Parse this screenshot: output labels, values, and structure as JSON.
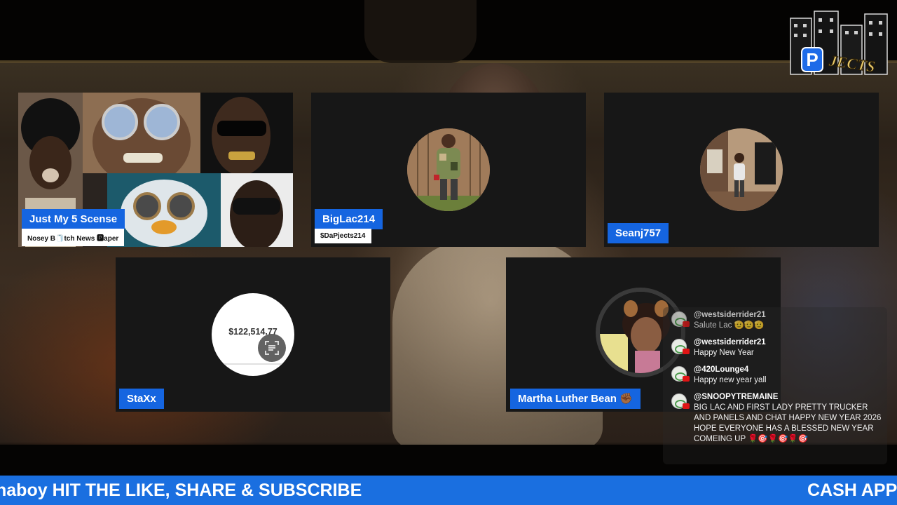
{
  "tiles": {
    "tile1": {
      "name": "Just My 5 Scense",
      "subtitle": "Nosey B🧻tch News 🅿aper"
    },
    "tile2": {
      "name": "BigLac214",
      "subtitle": "$DaPjects214"
    },
    "tile3": {
      "name": "Seanj757"
    },
    "tile4": {
      "name": "StaXx",
      "avatar_text": "$122,514.77"
    },
    "tile5": {
      "name": "Martha Luther Bean ✊🏾"
    }
  },
  "chat": [
    {
      "author": "@westsiderrider21",
      "text": "Salute Lac 🫡🫡🫡"
    },
    {
      "author": "@westsiderrider21",
      "text": "Happy New Year"
    },
    {
      "author": "@420Lounge4",
      "text": "Happy new year yall"
    },
    {
      "author": "@SNOOPYTREMAINE",
      "text": "BIG LAC AND FIRST LADY PRETTY TRUCKER AND PANELS AND CHAT HAPPY NEW YEAR 2026 HOPE EVERYONE HAS A BLESSED NEW YEAR COMEING UP 🌹🎯🌹🎯🌹🎯"
    }
  ],
  "ticker": {
    "left_text": "naboy HIT THE LIKE, SHARE & SUBSCRIBE",
    "right_text": "CASH APP"
  },
  "logo": {
    "letter": "P",
    "word": "JECTS"
  },
  "colors": {
    "name_tag_bg": "#1565e0",
    "ticker_bg": "#1a6fe0",
    "tile_bg": "#171717"
  },
  "icons": [
    "scan-icon",
    "youtube-icon"
  ]
}
